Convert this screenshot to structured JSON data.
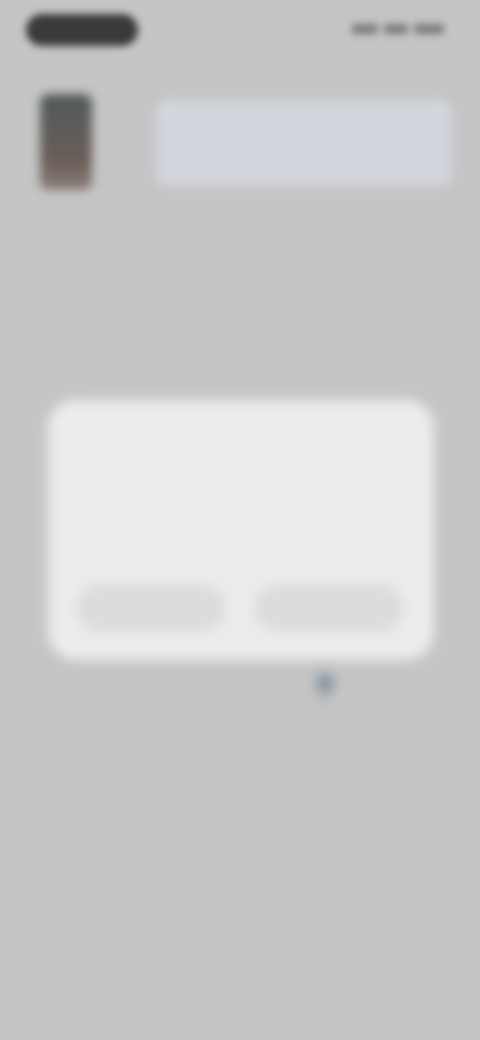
{
  "status_bar": {
    "time": "",
    "icons": [
      "signal-icon",
      "wifi-icon",
      "battery-icon"
    ]
  },
  "product": {
    "title": "",
    "subtitle": ""
  },
  "dialog": {
    "title": "",
    "body": "",
    "secondary_button": "",
    "primary_button": ""
  },
  "colors": {
    "background": "#c5c5c5",
    "dialog": "#ececec",
    "button": "#dcdcdc"
  }
}
